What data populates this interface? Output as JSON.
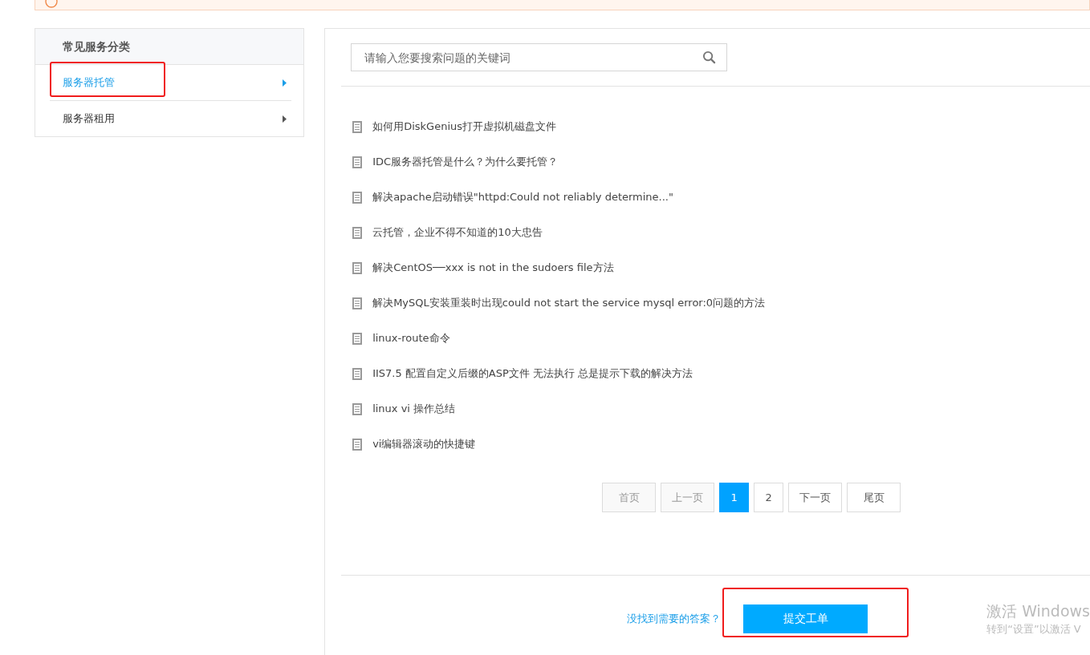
{
  "sidebar": {
    "title": "常见服务分类",
    "items": [
      {
        "label": "服务器托管",
        "selected": true,
        "highlighted": true
      },
      {
        "label": "服务器租用",
        "selected": false,
        "highlighted": false
      }
    ]
  },
  "search": {
    "placeholder": "请输入您要搜索问题的关键词"
  },
  "articles": [
    {
      "title": "如何用DiskGenius打开虚拟机磁盘文件"
    },
    {
      "title": "IDC服务器托管是什么？为什么要托管？"
    },
    {
      "title": "解决apache启动错误\"httpd:Could not reliably determine...\""
    },
    {
      "title": "云托管，企业不得不知道的10大忠告"
    },
    {
      "title": "解决CentOS──xxx is not in the sudoers file方法"
    },
    {
      "title": "解决MySQL安装重装时出现could not start the service mysql error:0问题的方法"
    },
    {
      "title": "linux-route命令"
    },
    {
      "title": "IIS7.5 配置自定义后缀的ASP文件 无法执行 总是提示下载的解决方法"
    },
    {
      "title": "linux vi 操作总结"
    },
    {
      "title": "vi编辑器滚动的快捷键"
    }
  ],
  "pagination": [
    {
      "label": "首页",
      "kind": "nav",
      "disabled": true,
      "selected": false
    },
    {
      "label": "上一页",
      "kind": "nav",
      "disabled": true,
      "selected": false
    },
    {
      "label": "1",
      "kind": "page",
      "disabled": false,
      "selected": true
    },
    {
      "label": "2",
      "kind": "page",
      "disabled": false,
      "selected": false
    },
    {
      "label": "下一页",
      "kind": "nav",
      "disabled": false,
      "selected": false
    },
    {
      "label": "尾页",
      "kind": "nav",
      "disabled": false,
      "selected": false
    }
  ],
  "footer": {
    "question_link": "没找到需要的答案？",
    "submit_button": "提交工单",
    "submit_highlighted": true
  },
  "activation_notice": {
    "title": "激活 Windows",
    "subtitle": "转到“设置”以激活 V"
  }
}
